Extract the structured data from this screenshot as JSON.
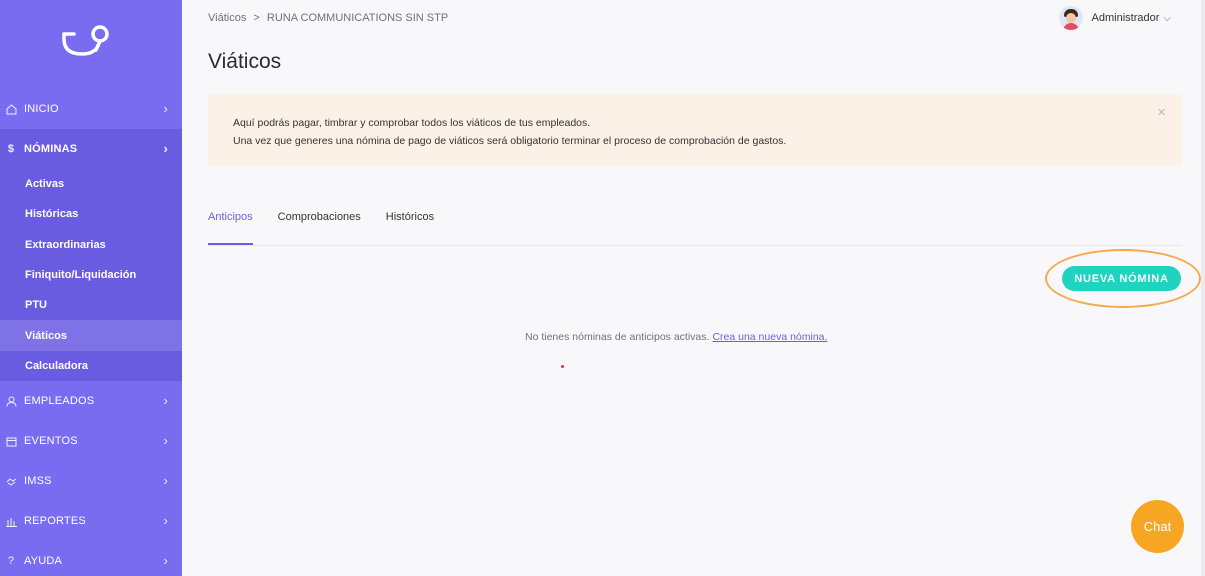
{
  "sidebar": {
    "nav": [
      {
        "label": "INICIO",
        "icon": "home-icon",
        "chev": "›"
      },
      {
        "label": "NÓMINAS",
        "icon": "dollar-icon",
        "chev": "›"
      },
      {
        "label": "EMPLEADOS",
        "icon": "user-icon",
        "chev": "›"
      },
      {
        "label": "EVENTOS",
        "icon": "calendar-icon",
        "chev": "›"
      },
      {
        "label": "IMSS",
        "icon": "handshake-icon",
        "chev": "›"
      },
      {
        "label": "REPORTES",
        "icon": "bar-chart-icon",
        "chev": "›"
      },
      {
        "label": "AYUDA",
        "icon": "question-icon",
        "chev": "›"
      }
    ],
    "submenu": [
      "Activas",
      "Históricas",
      "Extraordinarias",
      "Finiquito/Liquidación",
      "PTU",
      "Viáticos",
      "Calculadora"
    ],
    "active_sub": "Viáticos"
  },
  "header": {
    "breadcrumb": [
      "Viáticos",
      "RUNA COMMUNICATIONS SIN STP"
    ],
    "breadcrumb_sep": ">",
    "user": "Administrador",
    "user_caret": "⌵"
  },
  "page": {
    "title": "Viáticos",
    "alert_line1": "Aquí podrás pagar, timbrar y comprobar todos los viáticos de tus empleados.",
    "alert_line2": "Una vez que generes una nómina de pago de viáticos será obligatorio terminar el proceso de comprobación de gastos.",
    "alert_close": "×",
    "tabs": [
      "Anticipos",
      "Comprobaciones",
      "Históricos"
    ],
    "active_tab": "Anticipos",
    "new_button": "NUEVA NÓMINA",
    "empty_text": "No tienes nóminas de anticipos activas.",
    "empty_link": "Crea una nueva nómina."
  },
  "chat": {
    "label": "Chat"
  },
  "colors": {
    "sidebar": "#7a6cf0",
    "accent": "#6b5fe0",
    "button": "#1ed3c0",
    "chat": "#f6a623",
    "alert_bg": "#fbf1e6"
  }
}
